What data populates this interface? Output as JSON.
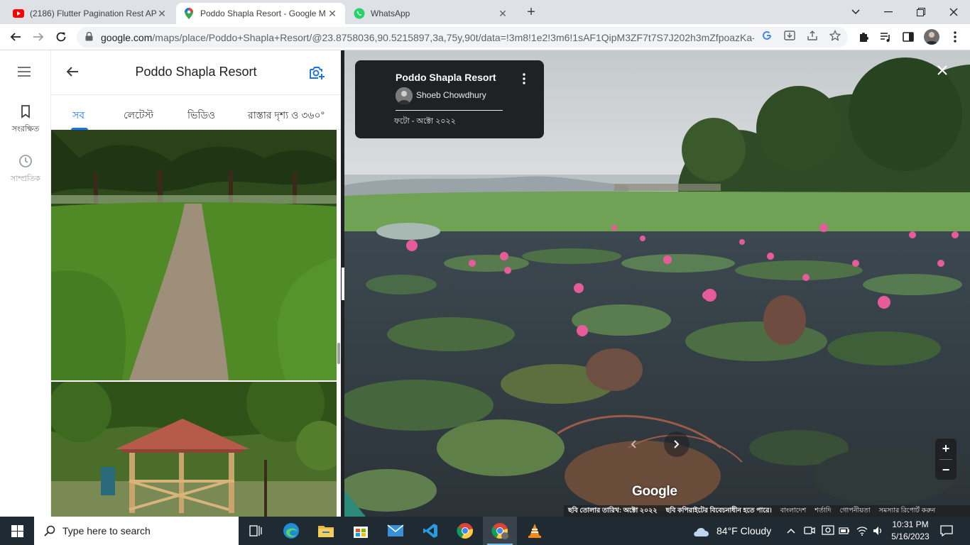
{
  "browser": {
    "tabs": [
      {
        "title": "(2186) Flutter Pagination Rest AP",
        "icon": "youtube-icon",
        "active": false
      },
      {
        "title": "Poddo Shapla Resort - Google M",
        "icon": "google-maps-icon",
        "active": true
      },
      {
        "title": "WhatsApp",
        "icon": "whatsapp-icon",
        "active": false
      }
    ],
    "url_host": "google.com",
    "url_path": "/maps/place/Poddo+Shapla+Resort/@23.8758036,90.5215897,3a,75y,90t/data=!3m8!1e2!3m6!1sAF1QipM3ZF7t7S7J202h3mZfpoazKa-..."
  },
  "rail": {
    "saved_label": "সংরক্ষিত",
    "recent_label": "সাম্প্রতিক"
  },
  "panel": {
    "title": "Poddo Shapla Resort",
    "tabs": [
      "সব",
      "লেটেস্ট",
      "ভিডিও",
      "রাস্তার দৃশ্য ও ৩৬০°"
    ]
  },
  "viewer": {
    "title": "Poddo Shapla Resort",
    "author": "Shoeb Chowdhury",
    "date": "ফটো - অক্টো ২০২২",
    "logo": "Google",
    "footer": {
      "capture": "ছবি তোলার তারিখ: অক্টো ২০২২",
      "copyright": "ছবি কপিরাইটের বিবেচনাধীন হতে পারে।",
      "country": "বাংলাদেশ",
      "terms": "শর্তাদি",
      "privacy": "গোপনীয়তা",
      "report": "সমস্যার রিপোর্ট করুন"
    }
  },
  "taskbar": {
    "search_placeholder": "Type here to search",
    "weather": "84°F  Cloudy",
    "time": "10:31 PM",
    "date": "5/16/2023"
  },
  "colors": {
    "accent": "#1a73e8",
    "taskbar": "#1f2a33",
    "tabstrip": "#dee1e6"
  }
}
